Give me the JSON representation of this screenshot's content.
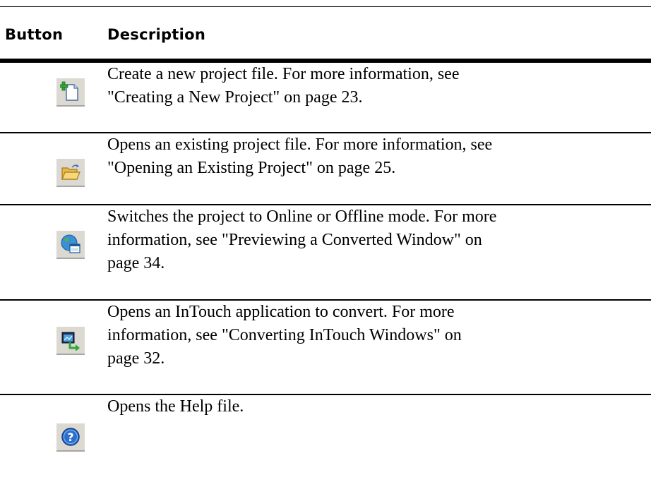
{
  "table": {
    "headers": {
      "button": "Button",
      "description": "Description"
    },
    "rows": [
      {
        "icon": "new-project-icon",
        "lines": [
          "Create a new project file. For more information, see",
          "\"Creating a New Project\" on page 23."
        ]
      },
      {
        "icon": "open-folder-icon",
        "lines": [
          "Opens an existing project file. For more information, see",
          "\"Opening an Existing Project\" on page 25."
        ]
      },
      {
        "icon": "globe-window-icon",
        "lines": [
          "Switches the project to Online or Offline mode. For more",
          "information, see \"Previewing a Converted Window\" on",
          "page 34."
        ]
      },
      {
        "icon": "intouch-convert-icon",
        "lines": [
          "Opens an InTouch application to convert. For more",
          "information, see \"Converting InTouch Windows\" on",
          "page 32."
        ]
      },
      {
        "icon": "help-icon",
        "lines": [
          "Opens the Help file."
        ]
      }
    ]
  }
}
